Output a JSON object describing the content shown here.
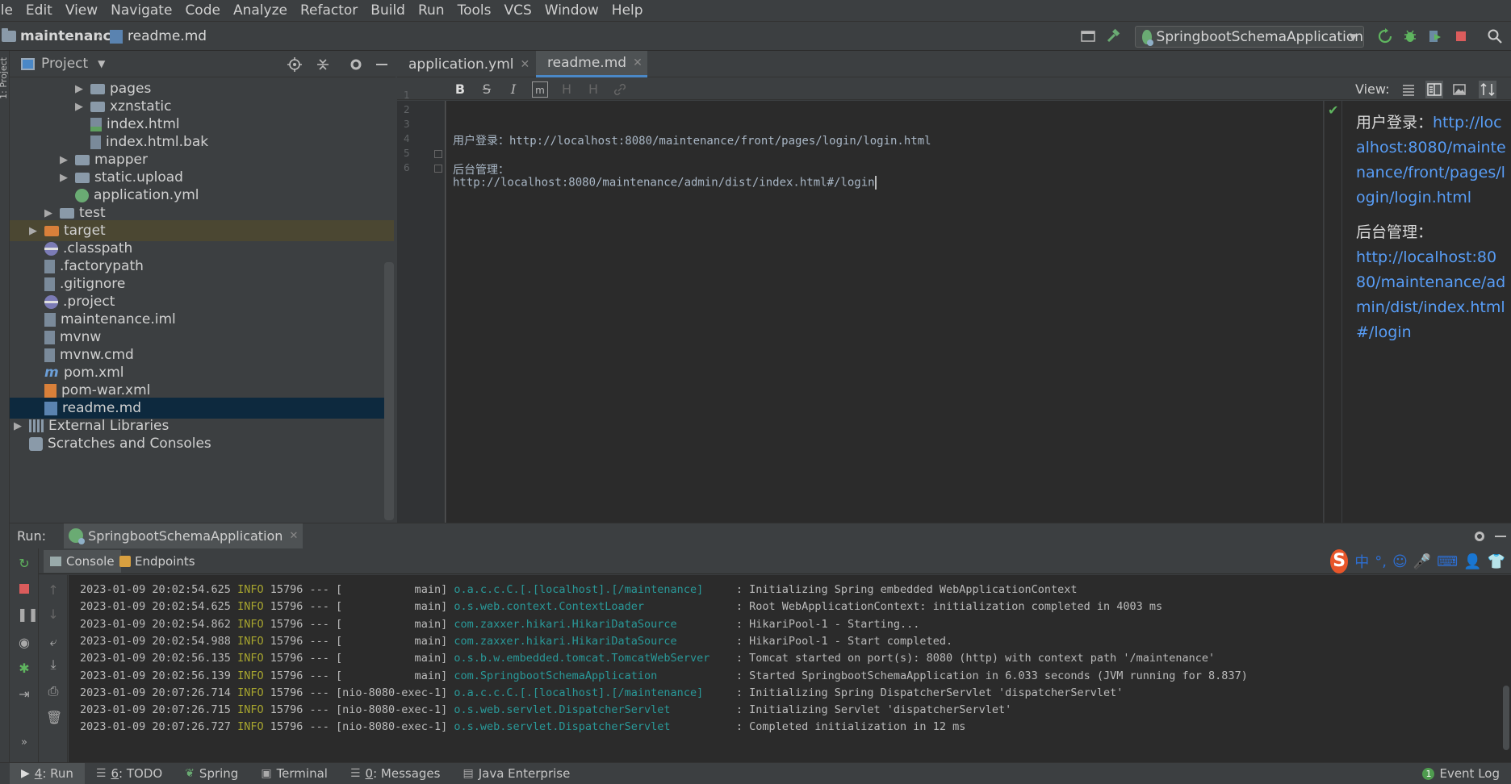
{
  "menu": [
    "ile",
    "Edit",
    "View",
    "Navigate",
    "Code",
    "Analyze",
    "Refactor",
    "Build",
    "Run",
    "Tools",
    "VCS",
    "Window",
    "Help"
  ],
  "navbar": {
    "project": "maintenance",
    "file": "readme.md",
    "run_config": "SpringbootSchemaApplication"
  },
  "project_panel": {
    "title": "Project",
    "side_label": "1: Project",
    "items": [
      {
        "name": "pages",
        "type": "folder",
        "indent": 4,
        "arrow": "▶"
      },
      {
        "name": "xznstatic",
        "type": "folder",
        "indent": 4,
        "arrow": "▶"
      },
      {
        "name": "index.html",
        "type": "html",
        "indent": 4,
        "arrow": ""
      },
      {
        "name": "index.html.bak",
        "type": "generic",
        "indent": 4,
        "arrow": ""
      },
      {
        "name": "mapper",
        "type": "folder",
        "indent": 3,
        "arrow": "▶"
      },
      {
        "name": "static.upload",
        "type": "folder",
        "indent": 3,
        "arrow": "▶"
      },
      {
        "name": "application.yml",
        "type": "yml",
        "indent": 3,
        "arrow": ""
      },
      {
        "name": "test",
        "type": "folder",
        "indent": 2,
        "arrow": "▶"
      },
      {
        "name": "target",
        "type": "folder-orange",
        "indent": 1,
        "arrow": "▶"
      },
      {
        "name": ".classpath",
        "type": "eclipse",
        "indent": 1,
        "arrow": ""
      },
      {
        "name": ".factorypath",
        "type": "generic",
        "indent": 1,
        "arrow": ""
      },
      {
        "name": ".gitignore",
        "type": "generic",
        "indent": 1,
        "arrow": ""
      },
      {
        "name": ".project",
        "type": "eclipse",
        "indent": 1,
        "arrow": ""
      },
      {
        "name": "maintenance.iml",
        "type": "iml",
        "indent": 1,
        "arrow": ""
      },
      {
        "name": "mvnw",
        "type": "generic",
        "indent": 1,
        "arrow": ""
      },
      {
        "name": "mvnw.cmd",
        "type": "generic",
        "indent": 1,
        "arrow": ""
      },
      {
        "name": "pom.xml",
        "type": "m",
        "indent": 1,
        "arrow": ""
      },
      {
        "name": "pom-war.xml",
        "type": "xml",
        "indent": 1,
        "arrow": ""
      },
      {
        "name": "readme.md",
        "type": "md",
        "indent": 1,
        "arrow": ""
      },
      {
        "name": "External Libraries",
        "type": "lib",
        "indent": 0,
        "arrow": "▶"
      },
      {
        "name": "Scratches and Consoles",
        "type": "scratch",
        "indent": 0,
        "arrow": ""
      }
    ]
  },
  "editor": {
    "tabs": [
      {
        "label": "application.yml",
        "active": false
      },
      {
        "label": "readme.md",
        "active": true
      }
    ],
    "line_numbers": [
      "1",
      "2",
      "3",
      "4",
      "5",
      "6"
    ],
    "lines": [
      "",
      "",
      "用户登录：http://localhost:8080/maintenance/front/pages/login/login.html",
      "",
      "后台管理：",
      "http://localhost:8080/maintenance/admin/dist/index.html#/login"
    ],
    "toolbar": [
      "B",
      "S",
      "I",
      "m",
      "H",
      "H",
      "link"
    ]
  },
  "preview": {
    "view_label": "View:",
    "p1_label": "用户登录：",
    "p1_link": "http://localhost:8080/maintenance/front/pages/login/login.html",
    "p2_label": "后台管理：",
    "p2_link": "http://localhost:8080/maintenance/admin/dist/index.html#/login"
  },
  "run": {
    "label": "Run:",
    "tab": "SpringbootSchemaApplication",
    "subtabs": [
      "Console",
      "Endpoints"
    ],
    "log": [
      {
        "ts": "2023-01-09 20:02:54.625",
        "level": "INFO",
        "pid": "15796",
        "sep": "--- [",
        "thread": "           main]",
        "cls": "o.a.c.c.C.[.[localhost].[/maintenance]   ",
        "msg": " : Initializing Spring embedded WebApplicationContext"
      },
      {
        "ts": "2023-01-09 20:02:54.625",
        "level": "INFO",
        "pid": "15796",
        "sep": "--- [",
        "thread": "           main]",
        "cls": "o.s.web.context.ContextLoader            ",
        "msg": " : Root WebApplicationContext: initialization completed in 4003 ms"
      },
      {
        "ts": "2023-01-09 20:02:54.862",
        "level": "INFO",
        "pid": "15796",
        "sep": "--- [",
        "thread": "           main]",
        "cls": "com.zaxxer.hikari.HikariDataSource       ",
        "msg": " : HikariPool-1 - Starting..."
      },
      {
        "ts": "2023-01-09 20:02:54.988",
        "level": "INFO",
        "pid": "15796",
        "sep": "--- [",
        "thread": "           main]",
        "cls": "com.zaxxer.hikari.HikariDataSource       ",
        "msg": " : HikariPool-1 - Start completed."
      },
      {
        "ts": "2023-01-09 20:02:56.135",
        "level": "INFO",
        "pid": "15796",
        "sep": "--- [",
        "thread": "           main]",
        "cls": "o.s.b.w.embedded.tomcat.TomcatWebServer  ",
        "msg": " : Tomcat started on port(s): 8080 (http) with context path '/maintenance'"
      },
      {
        "ts": "2023-01-09 20:02:56.139",
        "level": "INFO",
        "pid": "15796",
        "sep": "--- [",
        "thread": "           main]",
        "cls": "com.SpringbootSchemaApplication          ",
        "msg": " : Started SpringbootSchemaApplication in 6.033 seconds (JVM running for 8.837)"
      },
      {
        "ts": "2023-01-09 20:07:26.714",
        "level": "INFO",
        "pid": "15796",
        "sep": "--- [",
        "thread": "nio-8080-exec-1]",
        "cls": "o.a.c.c.C.[.[localhost].[/maintenance]   ",
        "msg": " : Initializing Spring DispatcherServlet 'dispatcherServlet'"
      },
      {
        "ts": "2023-01-09 20:07:26.715",
        "level": "INFO",
        "pid": "15796",
        "sep": "--- [",
        "thread": "nio-8080-exec-1]",
        "cls": "o.s.web.servlet.DispatcherServlet        ",
        "msg": " : Initializing Servlet 'dispatcherServlet'"
      },
      {
        "ts": "2023-01-09 20:07:26.727",
        "level": "INFO",
        "pid": "15796",
        "sep": "--- [",
        "thread": "nio-8080-exec-1]",
        "cls": "o.s.web.servlet.DispatcherServlet        ",
        "msg": " : Completed initialization in 12 ms"
      }
    ]
  },
  "ime": [
    "中",
    "°,",
    "☺",
    "🎤",
    "⌨",
    "👤",
    "👕"
  ],
  "bottom": {
    "run": "4: Run",
    "todo": "6: TODO",
    "spring": "Spring",
    "terminal": "Terminal",
    "messages": "0: Messages",
    "java_ee": "Java Enterprise",
    "event_log": "Event Log"
  },
  "colors": {
    "background": "#3c3f41",
    "editor_bg": "#2b2b2b",
    "link": "#589df6",
    "log_info": "#a7a52f",
    "log_class": "#299999",
    "selection": "#0d293e"
  }
}
